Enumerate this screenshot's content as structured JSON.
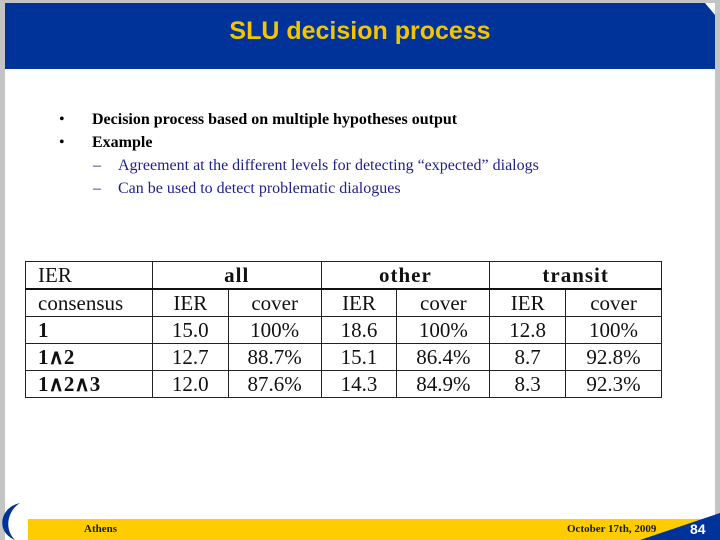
{
  "header": {
    "title": "SLU decision process"
  },
  "bullets": [
    {
      "marker": "•",
      "text": "Decision process based on multiple hypotheses output",
      "level": 1
    },
    {
      "marker": "•",
      "text": "Example",
      "level": 1
    },
    {
      "marker": "–",
      "text": "Agreement at the different levels for detecting “expected” dialogs",
      "level": 2
    },
    {
      "marker": "–",
      "text": "Can be used to detect problematic dialogues",
      "level": 2
    }
  ],
  "table": {
    "corner_top": "IER",
    "corner_bottom": "consensus",
    "groups": [
      "all",
      "other",
      "transit"
    ],
    "subheaders": [
      "IER",
      "cover",
      "IER",
      "cover",
      "IER",
      "cover"
    ],
    "rows": [
      {
        "label": "1",
        "values": [
          "15.0",
          "100%",
          "18.6",
          "100%",
          "12.8",
          "100%"
        ]
      },
      {
        "label": "1∧2",
        "values": [
          "12.7",
          "88.7%",
          "15.1",
          "86.4%",
          "8.7",
          "92.8%"
        ]
      },
      {
        "label": "1∧2∧3",
        "values": [
          "12.0",
          "87.6%",
          "14.3",
          "84.9%",
          "8.3",
          "92.3%"
        ]
      }
    ]
  },
  "footer": {
    "location": "Athens",
    "date": "October 17th,   2009",
    "page_number": "84"
  },
  "colors": {
    "brand_blue": "#003399",
    "title_yellow": "#f2c500",
    "footer_yellow": "#ffcc00"
  }
}
